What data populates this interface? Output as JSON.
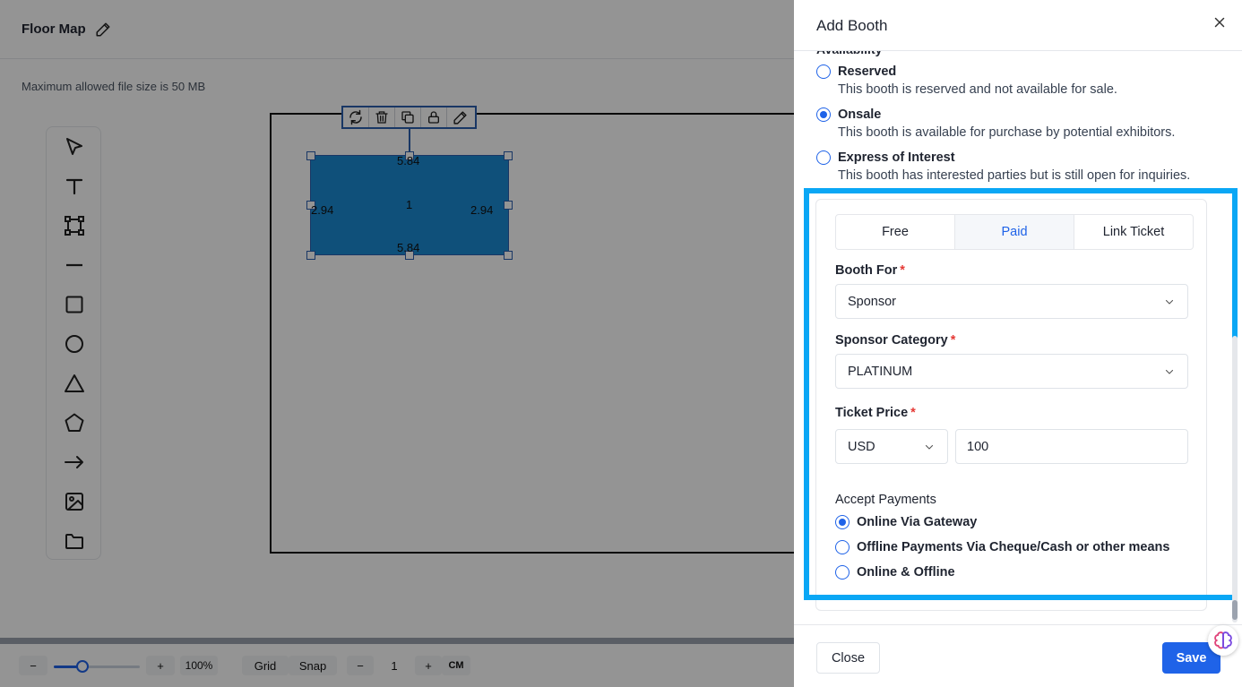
{
  "editor": {
    "title": "Floor Map",
    "file_note": "Maximum allowed file size is 50 MB",
    "tools": [
      "pointer-icon",
      "text-icon",
      "frame-icon",
      "line-icon",
      "square-icon",
      "circle-icon",
      "triangle-icon",
      "pentagon-icon",
      "arrow-icon",
      "image-icon",
      "folder-icon"
    ],
    "selection_tools": [
      "rotate-icon",
      "trash-icon",
      "duplicate-icon",
      "lock-icon",
      "pencil-icon"
    ],
    "booth": {
      "label": "1",
      "width_top": "5.84",
      "width_bottom": "5.84",
      "height_left": "2.94",
      "height_right": "2.94",
      "color": "#1a8ad2"
    },
    "bottom": {
      "zoom_minus": "−",
      "zoom_plus": "+",
      "zoom_level": "100%",
      "zoom_fraction": 0.33,
      "grid": "Grid",
      "snap": "Snap",
      "step_minus": "−",
      "step_value": "1",
      "step_plus": "+",
      "unit": "CM"
    }
  },
  "drawer": {
    "title": "Add Booth",
    "availability_label": "Availability",
    "availability": [
      {
        "title": "Reserved",
        "desc": "This booth is reserved and not available for sale.",
        "checked": false
      },
      {
        "title": "Onsale",
        "desc": "This booth is available for purchase by potential exhibitors.",
        "checked": true
      },
      {
        "title": "Express of Interest",
        "desc": "This booth has interested parties but is still open for inquiries.",
        "checked": false
      }
    ],
    "tabs": [
      {
        "label": "Free",
        "active": false
      },
      {
        "label": "Paid",
        "active": true
      },
      {
        "label": "Link Ticket",
        "active": false
      }
    ],
    "booth_for": {
      "label": "Booth For",
      "required": "*",
      "value": "Sponsor"
    },
    "sponsor_category": {
      "label": "Sponsor Category",
      "required": "*",
      "value": "PLATINUM"
    },
    "ticket_price": {
      "label": "Ticket Price",
      "required": "*",
      "currency": "USD",
      "amount": "100"
    },
    "accept_payments": {
      "label": "Accept Payments",
      "options": [
        {
          "label": "Online Via Gateway",
          "checked": true
        },
        {
          "label": "Offline Payments Via Cheque/Cash or other means",
          "checked": false
        },
        {
          "label": "Online & Offline",
          "checked": false
        }
      ]
    },
    "footer": {
      "close": "Close",
      "save": "Save"
    },
    "accent": "#1f63e8",
    "highlight_color": "#0aa7f5"
  }
}
